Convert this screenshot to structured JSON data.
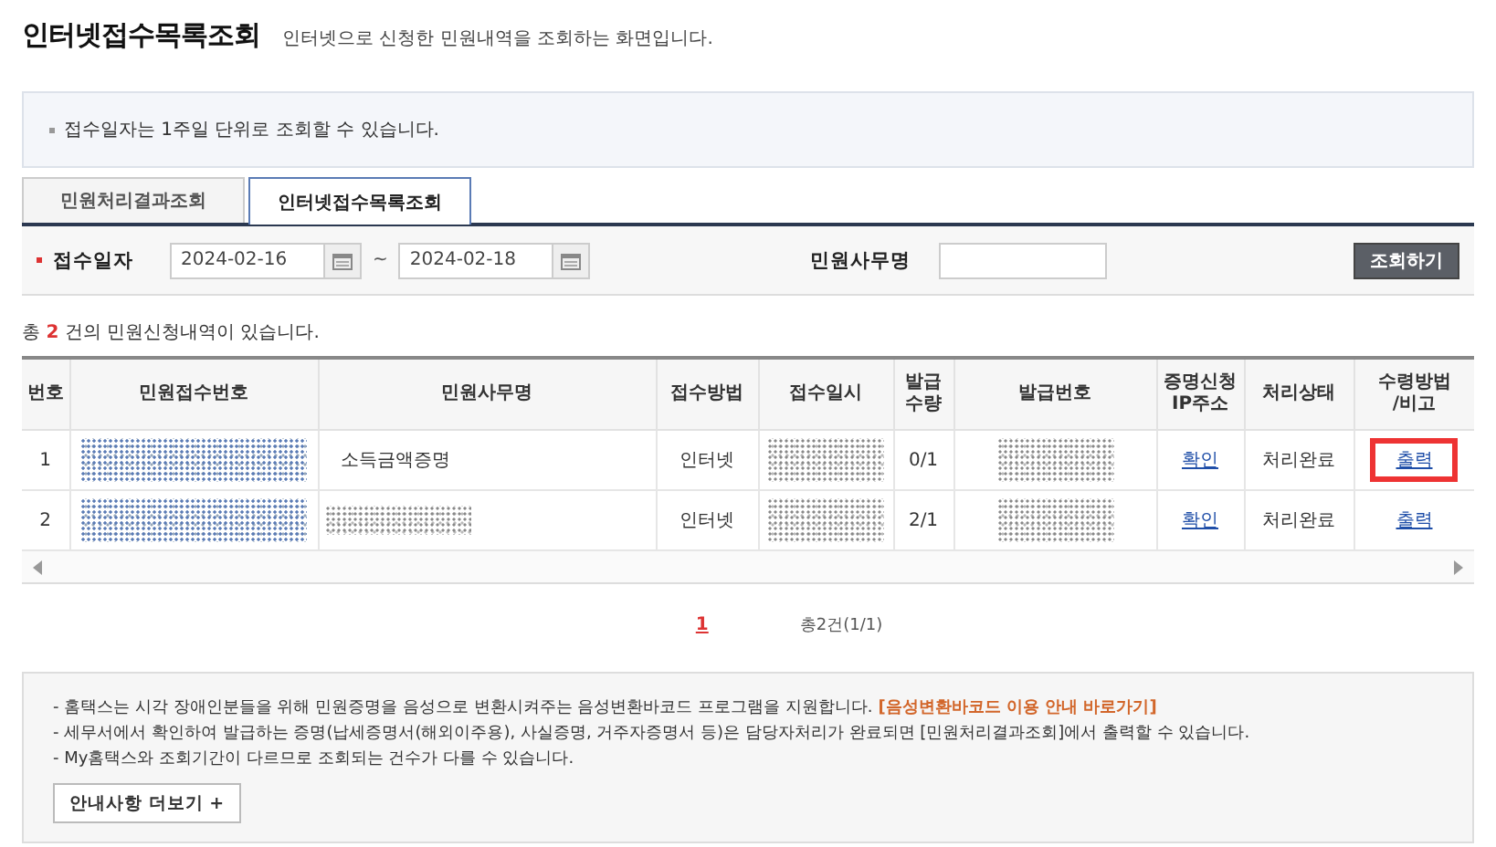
{
  "page": {
    "title": "인터넷접수목록조회",
    "subtitle": "인터넷으로 신청한 민원내역을 조회하는 화면입니다."
  },
  "notice": "접수일자는 1주일 단위로 조회할 수 있습니다.",
  "tabs": [
    {
      "label": "민원처리결과조회",
      "selected": false
    },
    {
      "label": "인터넷접수목록조회",
      "selected": true
    }
  ],
  "search": {
    "date_label": "접수일자",
    "date_from": "2024-02-16",
    "separator": "~",
    "date_to": "2024-02-18",
    "name_label": "민원사무명",
    "button": "조회하기"
  },
  "summary": {
    "prefix": "총",
    "count": "2",
    "suffix": "건의 민원신청내역이 있습니다."
  },
  "table": {
    "columns": [
      "번호",
      "민원접수번호",
      "민원사무명",
      "접수방법",
      "접수일시",
      "발급\n수량",
      "발급번호",
      "증명신청\nIP주소",
      "처리상태",
      "수령방법\n/비고"
    ],
    "rows": [
      {
        "cells": [
          {
            "kind": "text",
            "text": "1"
          },
          {
            "kind": "redacted"
          },
          {
            "kind": "text",
            "text": "소득금액증명"
          },
          {
            "kind": "text",
            "text": "인터넷"
          },
          {
            "kind": "redacted"
          },
          {
            "kind": "text",
            "text": "0/1"
          },
          {
            "kind": "redacted"
          },
          {
            "kind": "link",
            "text": "확인",
            "highlighted": false
          },
          {
            "kind": "text",
            "text": "처리완료"
          },
          {
            "kind": "link",
            "text": "출력",
            "highlighted": true
          }
        ]
      },
      {
        "cells": [
          {
            "kind": "text",
            "text": "2"
          },
          {
            "kind": "redacted"
          },
          {
            "kind": "redacted"
          },
          {
            "kind": "text",
            "text": "인터넷"
          },
          {
            "kind": "redacted"
          },
          {
            "kind": "text",
            "text": "2/1"
          },
          {
            "kind": "redacted"
          },
          {
            "kind": "link",
            "text": "확인",
            "highlighted": false
          },
          {
            "kind": "text",
            "text": "처리완료"
          },
          {
            "kind": "link",
            "text": "출력",
            "highlighted": false
          }
        ]
      }
    ]
  },
  "pagination": {
    "pages": [
      {
        "label": "1",
        "selected": true
      }
    ],
    "total": "총2건(1/1)"
  },
  "notes": [
    "- 홈택스는 시각 장애인분들을 위해 민원증명을 음성으로 변환시켜주는 음성변환바코드 프로그램을 지원합니다.",
    "- 세무서에서 확인하여 발급하는 증명(납세증명서(해외이주용), 사실증명, 거주자증명서 등)은 담당자처리가 완료되면 [민원처리결과조회]에서 출력할 수 있습니다.",
    "- My홈택스와 조회기간이 다르므로 조회되는 건수가 다를 수 있습니다."
  ],
  "notes_link": "[음성변환바코드 이용 안내 바로가기]",
  "more_button": "안내사항 더보기 +"
}
